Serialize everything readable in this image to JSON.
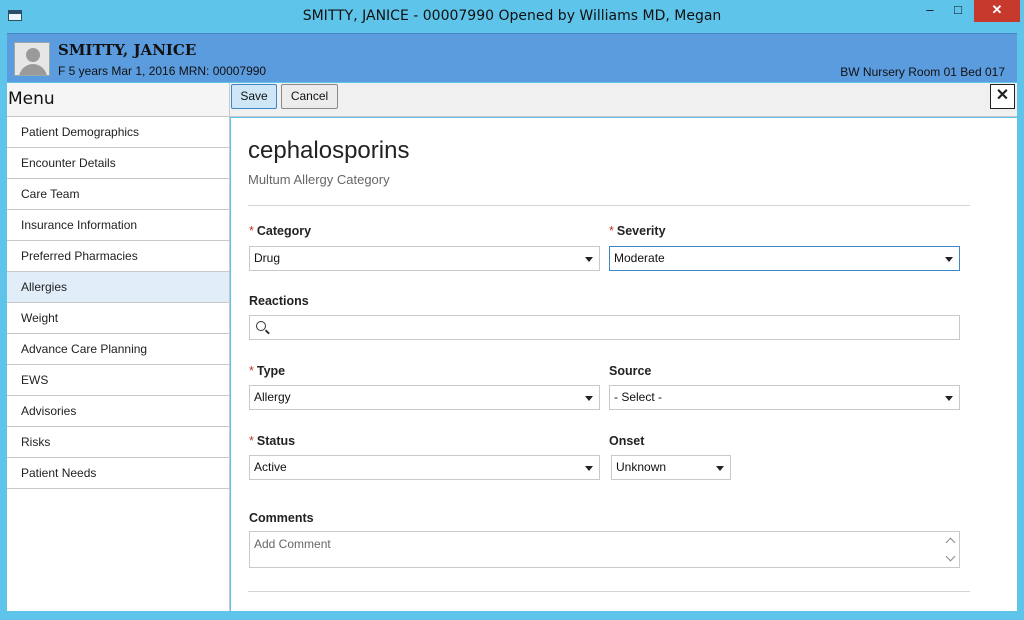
{
  "window": {
    "title": "SMITTY, JANICE - 00007990 Opened by Williams MD, Megan",
    "min_label": "–",
    "max_label": "□",
    "close_label": "✕"
  },
  "patient": {
    "name": "SMITTY, JANICE",
    "info": "F 5 years Mar 1, 2016 MRN: 00007990",
    "location": "BW Nursery Room 01 Bed 017"
  },
  "menu": {
    "title": "Menu",
    "items": [
      {
        "label": "Patient Demographics"
      },
      {
        "label": "Encounter Details"
      },
      {
        "label": "Care Team"
      },
      {
        "label": "Insurance Information"
      },
      {
        "label": "Preferred Pharmacies"
      },
      {
        "label": "Allergies"
      },
      {
        "label": "Weight"
      },
      {
        "label": "Advance Care Planning"
      },
      {
        "label": "EWS"
      },
      {
        "label": "Advisories"
      },
      {
        "label": "Risks"
      },
      {
        "label": "Patient Needs"
      }
    ],
    "active_item": "Allergies"
  },
  "toolbar": {
    "save_label": "Save",
    "cancel_label": "Cancel",
    "close_label": "✕"
  },
  "allergy": {
    "name": "cephalosporins",
    "subtitle": "Multum Allergy Category"
  },
  "form": {
    "required_marker": "*",
    "category": {
      "label": "Category",
      "value": "Drug"
    },
    "severity": {
      "label": "Severity",
      "value": "Moderate"
    },
    "reactions": {
      "label": "Reactions",
      "value": ""
    },
    "type": {
      "label": "Type",
      "value": "Allergy"
    },
    "source": {
      "label": "Source",
      "value": "- Select -"
    },
    "status": {
      "label": "Status",
      "value": "Active"
    },
    "onset": {
      "label": "Onset",
      "value": "Unknown"
    },
    "comments": {
      "label": "Comments",
      "placeholder": "Add Comment"
    }
  },
  "colors": {
    "titlebar": "#5ec4ea",
    "patient_header": "#5b9cdf",
    "active_menu": "#e1eef9",
    "required": "#c0392b",
    "save_button": "#cfe6f7"
  }
}
